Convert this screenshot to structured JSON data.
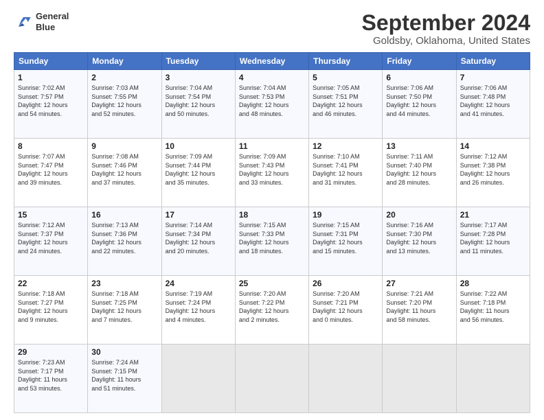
{
  "header": {
    "logo_line1": "General",
    "logo_line2": "Blue",
    "title": "September 2024",
    "subtitle": "Goldsby, Oklahoma, United States"
  },
  "columns": [
    "Sunday",
    "Monday",
    "Tuesday",
    "Wednesday",
    "Thursday",
    "Friday",
    "Saturday"
  ],
  "weeks": [
    [
      {
        "day": "1",
        "lines": [
          "Sunrise: 7:02 AM",
          "Sunset: 7:57 PM",
          "Daylight: 12 hours",
          "and 54 minutes."
        ]
      },
      {
        "day": "2",
        "lines": [
          "Sunrise: 7:03 AM",
          "Sunset: 7:55 PM",
          "Daylight: 12 hours",
          "and 52 minutes."
        ]
      },
      {
        "day": "3",
        "lines": [
          "Sunrise: 7:04 AM",
          "Sunset: 7:54 PM",
          "Daylight: 12 hours",
          "and 50 minutes."
        ]
      },
      {
        "day": "4",
        "lines": [
          "Sunrise: 7:04 AM",
          "Sunset: 7:53 PM",
          "Daylight: 12 hours",
          "and 48 minutes."
        ]
      },
      {
        "day": "5",
        "lines": [
          "Sunrise: 7:05 AM",
          "Sunset: 7:51 PM",
          "Daylight: 12 hours",
          "and 46 minutes."
        ]
      },
      {
        "day": "6",
        "lines": [
          "Sunrise: 7:06 AM",
          "Sunset: 7:50 PM",
          "Daylight: 12 hours",
          "and 44 minutes."
        ]
      },
      {
        "day": "7",
        "lines": [
          "Sunrise: 7:06 AM",
          "Sunset: 7:48 PM",
          "Daylight: 12 hours",
          "and 41 minutes."
        ]
      }
    ],
    [
      {
        "day": "8",
        "lines": [
          "Sunrise: 7:07 AM",
          "Sunset: 7:47 PM",
          "Daylight: 12 hours",
          "and 39 minutes."
        ]
      },
      {
        "day": "9",
        "lines": [
          "Sunrise: 7:08 AM",
          "Sunset: 7:46 PM",
          "Daylight: 12 hours",
          "and 37 minutes."
        ]
      },
      {
        "day": "10",
        "lines": [
          "Sunrise: 7:09 AM",
          "Sunset: 7:44 PM",
          "Daylight: 12 hours",
          "and 35 minutes."
        ]
      },
      {
        "day": "11",
        "lines": [
          "Sunrise: 7:09 AM",
          "Sunset: 7:43 PM",
          "Daylight: 12 hours",
          "and 33 minutes."
        ]
      },
      {
        "day": "12",
        "lines": [
          "Sunrise: 7:10 AM",
          "Sunset: 7:41 PM",
          "Daylight: 12 hours",
          "and 31 minutes."
        ]
      },
      {
        "day": "13",
        "lines": [
          "Sunrise: 7:11 AM",
          "Sunset: 7:40 PM",
          "Daylight: 12 hours",
          "and 28 minutes."
        ]
      },
      {
        "day": "14",
        "lines": [
          "Sunrise: 7:12 AM",
          "Sunset: 7:38 PM",
          "Daylight: 12 hours",
          "and 26 minutes."
        ]
      }
    ],
    [
      {
        "day": "15",
        "lines": [
          "Sunrise: 7:12 AM",
          "Sunset: 7:37 PM",
          "Daylight: 12 hours",
          "and 24 minutes."
        ]
      },
      {
        "day": "16",
        "lines": [
          "Sunrise: 7:13 AM",
          "Sunset: 7:36 PM",
          "Daylight: 12 hours",
          "and 22 minutes."
        ]
      },
      {
        "day": "17",
        "lines": [
          "Sunrise: 7:14 AM",
          "Sunset: 7:34 PM",
          "Daylight: 12 hours",
          "and 20 minutes."
        ]
      },
      {
        "day": "18",
        "lines": [
          "Sunrise: 7:15 AM",
          "Sunset: 7:33 PM",
          "Daylight: 12 hours",
          "and 18 minutes."
        ]
      },
      {
        "day": "19",
        "lines": [
          "Sunrise: 7:15 AM",
          "Sunset: 7:31 PM",
          "Daylight: 12 hours",
          "and 15 minutes."
        ]
      },
      {
        "day": "20",
        "lines": [
          "Sunrise: 7:16 AM",
          "Sunset: 7:30 PM",
          "Daylight: 12 hours",
          "and 13 minutes."
        ]
      },
      {
        "day": "21",
        "lines": [
          "Sunrise: 7:17 AM",
          "Sunset: 7:28 PM",
          "Daylight: 12 hours",
          "and 11 minutes."
        ]
      }
    ],
    [
      {
        "day": "22",
        "lines": [
          "Sunrise: 7:18 AM",
          "Sunset: 7:27 PM",
          "Daylight: 12 hours",
          "and 9 minutes."
        ]
      },
      {
        "day": "23",
        "lines": [
          "Sunrise: 7:18 AM",
          "Sunset: 7:25 PM",
          "Daylight: 12 hours",
          "and 7 minutes."
        ]
      },
      {
        "day": "24",
        "lines": [
          "Sunrise: 7:19 AM",
          "Sunset: 7:24 PM",
          "Daylight: 12 hours",
          "and 4 minutes."
        ]
      },
      {
        "day": "25",
        "lines": [
          "Sunrise: 7:20 AM",
          "Sunset: 7:22 PM",
          "Daylight: 12 hours",
          "and 2 minutes."
        ]
      },
      {
        "day": "26",
        "lines": [
          "Sunrise: 7:20 AM",
          "Sunset: 7:21 PM",
          "Daylight: 12 hours",
          "and 0 minutes."
        ]
      },
      {
        "day": "27",
        "lines": [
          "Sunrise: 7:21 AM",
          "Sunset: 7:20 PM",
          "Daylight: 11 hours",
          "and 58 minutes."
        ]
      },
      {
        "day": "28",
        "lines": [
          "Sunrise: 7:22 AM",
          "Sunset: 7:18 PM",
          "Daylight: 11 hours",
          "and 56 minutes."
        ]
      }
    ],
    [
      {
        "day": "29",
        "lines": [
          "Sunrise: 7:23 AM",
          "Sunset: 7:17 PM",
          "Daylight: 11 hours",
          "and 53 minutes."
        ]
      },
      {
        "day": "30",
        "lines": [
          "Sunrise: 7:24 AM",
          "Sunset: 7:15 PM",
          "Daylight: 11 hours",
          "and 51 minutes."
        ]
      },
      {
        "day": "",
        "lines": []
      },
      {
        "day": "",
        "lines": []
      },
      {
        "day": "",
        "lines": []
      },
      {
        "day": "",
        "lines": []
      },
      {
        "day": "",
        "lines": []
      }
    ]
  ]
}
